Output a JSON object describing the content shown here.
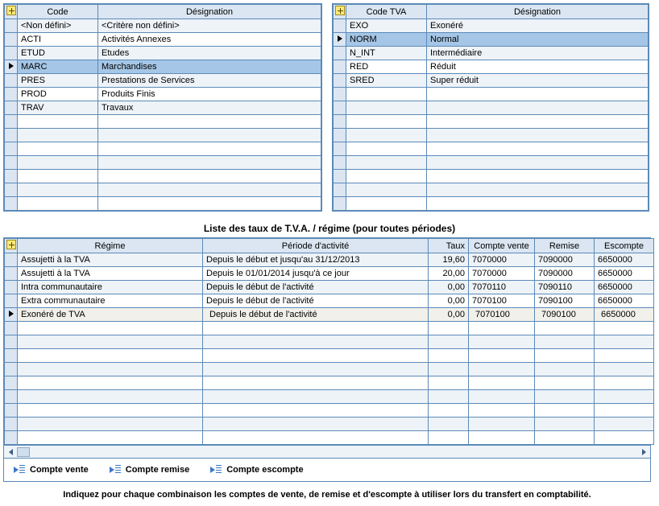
{
  "left_table": {
    "headers": {
      "code": "Code",
      "designation": "Désignation"
    },
    "rows": [
      {
        "code": "<Non défini>",
        "designation": "<Critère non défini>",
        "selected": false,
        "marker": false
      },
      {
        "code": "ACTI",
        "designation": "Activités Annexes",
        "selected": false,
        "marker": false
      },
      {
        "code": "ETUD",
        "designation": "Etudes",
        "selected": false,
        "marker": false
      },
      {
        "code": "MARC",
        "designation": "Marchandises",
        "selected": true,
        "marker": true
      },
      {
        "code": "PRES",
        "designation": "Prestations de Services",
        "selected": false,
        "marker": false
      },
      {
        "code": "PROD",
        "designation": "Produits Finis",
        "selected": false,
        "marker": false
      },
      {
        "code": "TRAV",
        "designation": "Travaux",
        "selected": false,
        "marker": false
      }
    ],
    "empty_rows": 7
  },
  "right_table": {
    "headers": {
      "code": "Code TVA",
      "designation": "Désignation"
    },
    "rows": [
      {
        "code": "EXO",
        "designation": "Exonéré",
        "selected": false,
        "marker": false
      },
      {
        "code": "NORM",
        "designation": "Normal",
        "selected": true,
        "marker": true
      },
      {
        "code": "N_INT",
        "designation": "Intermédiaire",
        "selected": false,
        "marker": false
      },
      {
        "code": "RED",
        "designation": "Réduit",
        "selected": false,
        "marker": false
      },
      {
        "code": "SRED",
        "designation": "Super réduit",
        "selected": false,
        "marker": false
      }
    ],
    "empty_rows": 9
  },
  "section_title": "Liste des taux de T.V.A. / régime (pour toutes périodes)",
  "bottom_table": {
    "headers": {
      "regime": "Régime",
      "periode": "Période d'activité",
      "taux": "Taux",
      "compte_vente": "Compte vente",
      "remise": "Remise",
      "escompte": "Escompte"
    },
    "rows": [
      {
        "regime": "Assujetti à la TVA",
        "periode": "Depuis le début et jusqu'au 31/12/2013",
        "taux": "19,60",
        "compte_vente": "7070000",
        "remise": "7090000",
        "escompte": "6650000"
      },
      {
        "regime": "Assujetti à la TVA",
        "periode": "Depuis le 01/01/2014 jusqu'à ce jour",
        "taux": "20,00",
        "compte_vente": "7070000",
        "remise": "7090000",
        "escompte": "6650000"
      },
      {
        "regime": "Intra communautaire",
        "periode": "Depuis le début de l'activité",
        "taux": "0,00",
        "compte_vente": "7070110",
        "remise": "7090110",
        "escompte": "6650000"
      },
      {
        "regime": "Extra communautaire",
        "periode": "Depuis le début de l'activité",
        "taux": "0,00",
        "compte_vente": "7070100",
        "remise": "7090100",
        "escompte": "6650000"
      }
    ],
    "edit_row": {
      "regime": "Exonéré de TVA",
      "periode": "Depuis le début de l'activité",
      "taux": "0,00",
      "compte_vente": "7070100",
      "remise": "7090100",
      "escompte": "6650000"
    },
    "empty_rows": 9
  },
  "buttons": {
    "compte_vente": "Compte vente",
    "compte_remise": "Compte remise",
    "compte_escompte": "Compte escompte"
  },
  "instruction": "Indiquez pour chaque combinaison les comptes de vente, de remise et d'escompte à utiliser lors du transfert en comptabilité."
}
